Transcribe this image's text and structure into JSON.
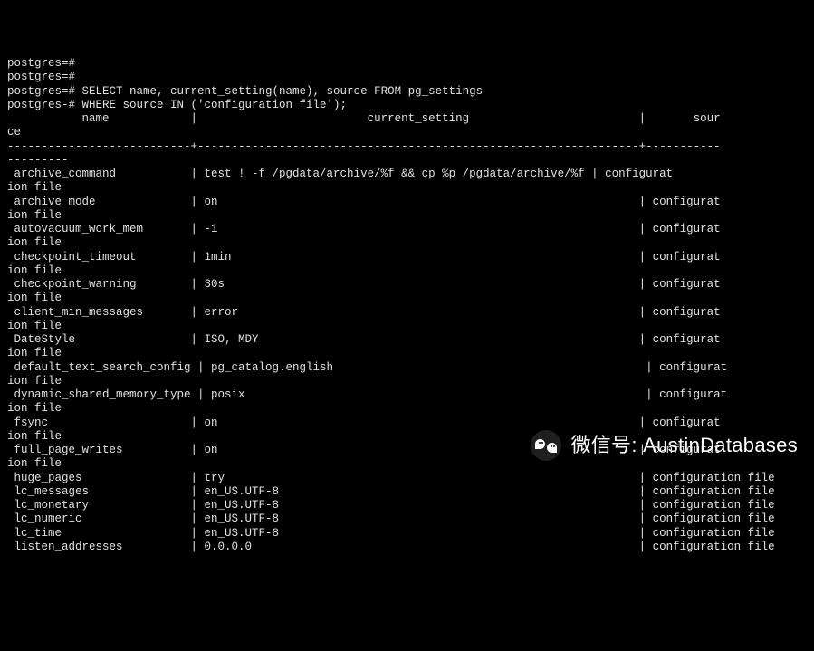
{
  "prompt_lines": [
    "postgres=#",
    "postgres=#",
    "postgres=# SELECT name, current_setting(name), source FROM pg_settings",
    "postgres-# WHERE source IN ('configuration file');"
  ],
  "header_line": "           name            |                         current_setting                         |       sour",
  "header_wrap": "ce",
  "separator_line": "---------------------------+-----------------------------------------------------------------+-----------",
  "separator_wrap": "---------",
  "rows_wrapped": [
    {
      "main": " archive_command           | test ! -f /pgdata/archive/%f && cp %p /pgdata/archive/%f | configurat",
      "wrap": "ion file"
    },
    {
      "main": " archive_mode              | on                                                              | configurat",
      "wrap": "ion file"
    },
    {
      "main": " autovacuum_work_mem       | -1                                                              | configurat",
      "wrap": "ion file"
    },
    {
      "main": " checkpoint_timeout        | 1min                                                            | configurat",
      "wrap": "ion file"
    },
    {
      "main": " checkpoint_warning        | 30s                                                             | configurat",
      "wrap": "ion file"
    },
    {
      "main": " client_min_messages       | error                                                           | configurat",
      "wrap": "ion file"
    },
    {
      "main": " DateStyle                 | ISO, MDY                                                        | configurat",
      "wrap": "ion file"
    },
    {
      "main": " default_text_search_config | pg_catalog.english                                              | configurat",
      "wrap": "ion file"
    },
    {
      "main": " dynamic_shared_memory_type | posix                                                           | configurat",
      "wrap": "ion file"
    },
    {
      "main": " fsync                     | on                                                              | configurat",
      "wrap": "ion file"
    },
    {
      "main": " full_page_writes          | on                                                              | configurat",
      "wrap": "ion file"
    }
  ],
  "rows_single": [
    " huge_pages                | try                                                             | configuration file",
    " lc_messages               | en_US.UTF-8                                                     | configuration file",
    " lc_monetary               | en_US.UTF-8                                                     | configuration file",
    " lc_numeric                | en_US.UTF-8                                                     | configuration file",
    " lc_time                   | en_US.UTF-8                                                     | configuration file",
    " listen_addresses          | 0.0.0.0                                                         | configuration file"
  ],
  "watermark": {
    "label_prefix": "微信号: ",
    "label_value": "AustinDatabases"
  }
}
